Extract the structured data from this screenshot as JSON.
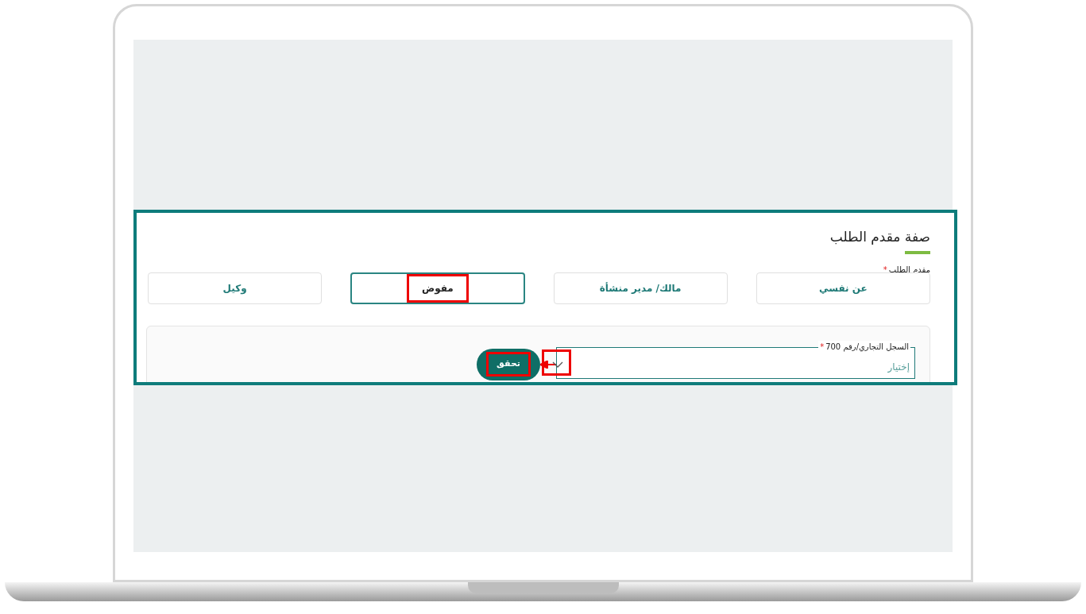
{
  "section": {
    "title": "صفة مقدم الطلب",
    "applicant_label": "مقدم الطلب",
    "required_mark": "*",
    "options": [
      {
        "label": "عن نفسي",
        "selected": false,
        "highlighted": false
      },
      {
        "label": "مالك/ مدير منشأة",
        "selected": false,
        "highlighted": false
      },
      {
        "label": "مفوض",
        "selected": true,
        "highlighted": true
      },
      {
        "label": "وكيل",
        "selected": false,
        "highlighted": false
      }
    ]
  },
  "record_field": {
    "label": "السجل التجاري/رقم 700",
    "required_mark": "*",
    "placeholder": "إختيار",
    "highlighted": true
  },
  "verify_button": {
    "label": "تحقق",
    "highlighted": true
  }
}
